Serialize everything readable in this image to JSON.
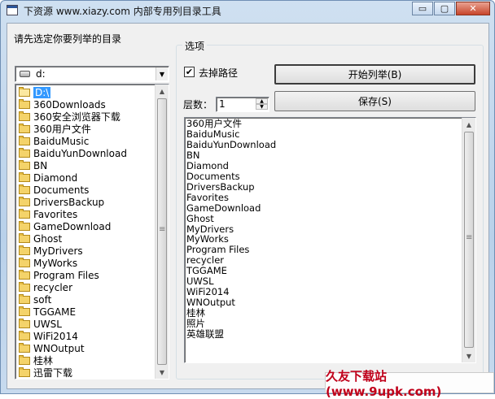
{
  "window": {
    "title": "下资源 www.xiazy.com 内部专用列目录工具",
    "minimize_label": "▭",
    "restore_label": "▢",
    "close_label": "✕"
  },
  "left_panel": {
    "prompt": "请先选定你要列举的目录",
    "drive": "d:",
    "directories": [
      {
        "label": "D:\\",
        "selected": true,
        "open": true
      },
      {
        "label": "360Downloads"
      },
      {
        "label": "360安全浏览器下载"
      },
      {
        "label": "360用户文件"
      },
      {
        "label": "BaiduMusic"
      },
      {
        "label": "BaiduYunDownload"
      },
      {
        "label": "BN"
      },
      {
        "label": "Diamond"
      },
      {
        "label": "Documents"
      },
      {
        "label": "DriversBackup"
      },
      {
        "label": "Favorites"
      },
      {
        "label": "GameDownload"
      },
      {
        "label": "Ghost"
      },
      {
        "label": "MyDrivers"
      },
      {
        "label": "MyWorks"
      },
      {
        "label": "Program Files"
      },
      {
        "label": "recycler"
      },
      {
        "label": "soft"
      },
      {
        "label": "TGGAME"
      },
      {
        "label": "UWSL"
      },
      {
        "label": "WiFi2014"
      },
      {
        "label": "WNOutput"
      },
      {
        "label": "桂林"
      },
      {
        "label": "迅雷下载"
      }
    ]
  },
  "options": {
    "group_title": "选项",
    "remove_path_label": "去掉路径",
    "remove_path_checked": true,
    "check_mark": "✔",
    "start_button": "开始列举(B)",
    "save_button": "保存(S)",
    "level_label": "层数：",
    "level_value": "1"
  },
  "output_list": [
    "360用户文件",
    "BaiduMusic",
    "BaiduYunDownload",
    "BN",
    "Diamond",
    "Documents",
    "DriversBackup",
    "Favorites",
    "GameDownload",
    "Ghost",
    "MyDrivers",
    "MyWorks",
    "Program Files",
    "recycler",
    "TGGAME",
    "UWSL",
    "WiFi2014",
    "WNOutput",
    "桂林",
    "照片",
    "英雄联盟"
  ],
  "watermark": "久友下载站(www.9upk.com)"
}
